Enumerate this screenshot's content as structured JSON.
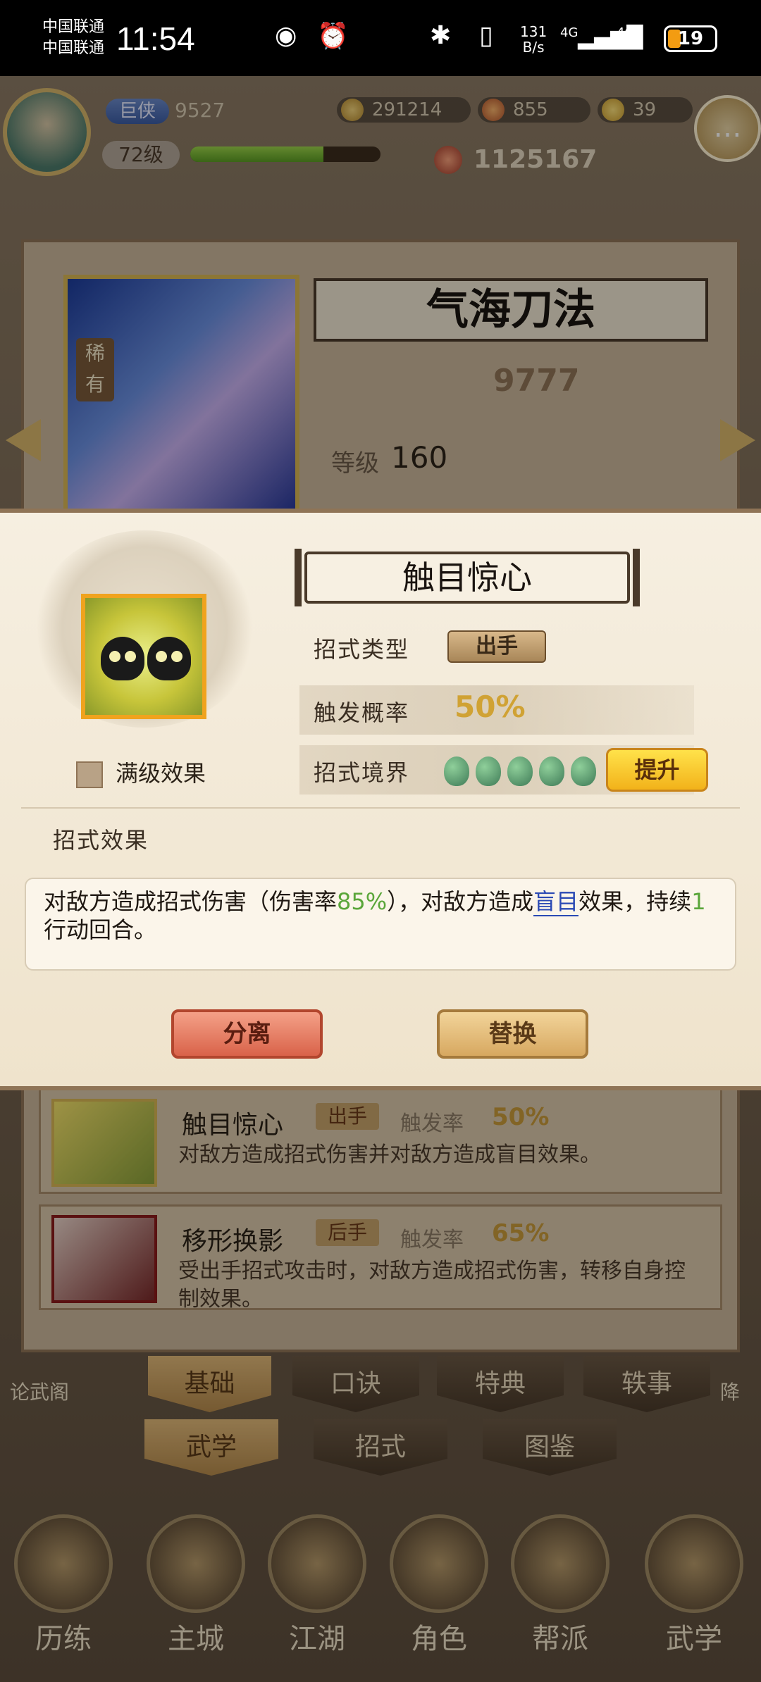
{
  "status_bar": {
    "carrier1": "中国联通",
    "carrier2": "中国联通",
    "time": "11:54",
    "speed_value": "131",
    "speed_unit": "B/s",
    "net1": "4G",
    "net2": "4G",
    "battery": "19",
    "icons": [
      "eye-icon",
      "alarm-icon",
      "bluetooth-icon",
      "vibrate-icon",
      "signal-icon",
      "signal-icon",
      "battery-icon"
    ]
  },
  "hud": {
    "title_badge": "巨侠",
    "power": "9527",
    "level": "72级",
    "xp_fraction": 0.7,
    "coins": "291214",
    "jade": "855",
    "gold": "39",
    "fight_value": "1125167"
  },
  "skill_card": {
    "rarity": "稀有",
    "name": "气海刀法",
    "score": "9777",
    "level_label": "等级",
    "level_value": "160"
  },
  "list": {
    "rows": [
      {
        "name": "触目惊心",
        "tag": "出手",
        "rate_label": "触发率",
        "rate_value": "50%",
        "desc": "对敌方造成招式伤害并对敌方造成盲目效果。"
      },
      {
        "name": "移形换影",
        "tag": "后手",
        "rate_label": "触发率",
        "rate_value": "65%",
        "desc": "受出手招式攻击时，对敌方造成招式伤害，转移自身控制效果。"
      }
    ]
  },
  "tabs": {
    "row1": [
      "基础",
      "口诀",
      "特典",
      "轶事"
    ],
    "row2": [
      "武学",
      "招式",
      "图鉴"
    ]
  },
  "bottom_nav": [
    "历练",
    "主城",
    "江湖",
    "角色",
    "帮派",
    "武学"
  ],
  "side_labels": {
    "left": "论武阁",
    "right": "降"
  },
  "popup": {
    "title": "触目惊心",
    "max_level_label": "满级效果",
    "type_label": "招式类型",
    "type_value": "出手",
    "rate_label": "触发概率",
    "rate_value": "50%",
    "realm_label": "招式境界",
    "realm_level": 5,
    "upgrade_label": "提升",
    "effect_heading": "招式效果",
    "effect": {
      "part1": "对敌方造成招式伤害（伤害率",
      "damage_rate": "85%",
      "part2": "），对敌方造成",
      "link": "盲目",
      "part3": "效果，持续",
      "turns": "1",
      "part4": "行动回合。"
    },
    "separate_label": "分离",
    "replace_label": "替换"
  }
}
